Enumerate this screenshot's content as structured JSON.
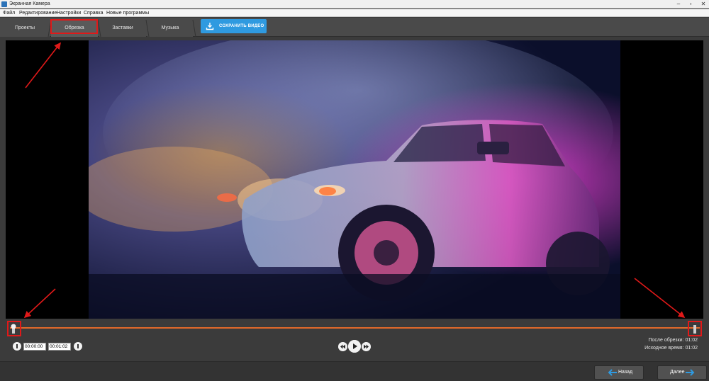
{
  "window": {
    "title": "Экранная Камера",
    "minimize": "–",
    "restore": "▫",
    "close": "✕"
  },
  "menu": {
    "file": "Файл",
    "edit": "Редактирование",
    "settings": "Настройки",
    "help": "Справка",
    "new_programs": "Новые программы"
  },
  "tabs": {
    "projects": "Проекты",
    "trim": "Обрезка",
    "intros": "Заставки",
    "music": "Музыка"
  },
  "save_button": {
    "label": "СОХРАНИТЬ ВИДЕО",
    "icon": "download-icon"
  },
  "player": {
    "start_time": "00:00:00",
    "end_time": "00:01:02",
    "trim_start_fraction": 0,
    "trim_end_fraction": 1
  },
  "trim_info": {
    "after_trim_label": "После обрезки:",
    "after_trim_value": "01:02",
    "original_label": "Исходное время:",
    "original_value": "01:02"
  },
  "footer": {
    "back_label": "Назад",
    "next_label": "Далее"
  },
  "colors": {
    "accent": "#2f9ae0",
    "timeline": "#e2692a",
    "highlight": "#e01919"
  }
}
